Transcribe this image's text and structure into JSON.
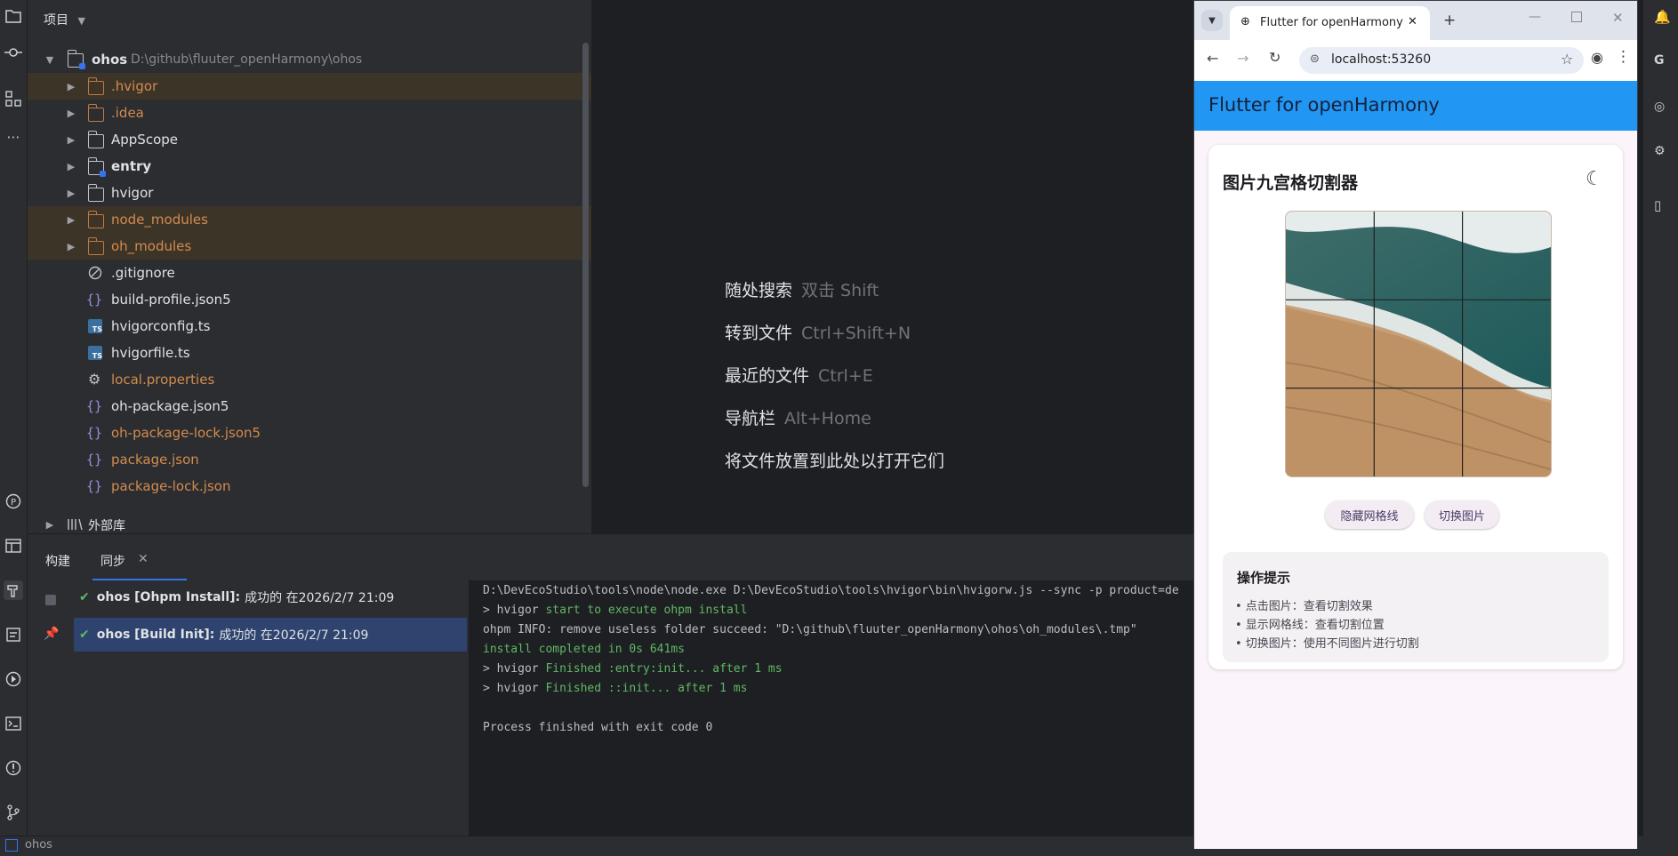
{
  "project_panel": {
    "header": "项目",
    "root": {
      "name": "ohos",
      "path": "D:\\github\\fluuter_openHarmony\\ohos"
    },
    "items": [
      {
        "label": ".hvigor",
        "kind": "folder",
        "color": "orange",
        "expandable": true,
        "highlight": true
      },
      {
        "label": ".idea",
        "kind": "folder",
        "color": "orange",
        "expandable": true,
        "highlight": false
      },
      {
        "label": "AppScope",
        "kind": "folder",
        "color": "default",
        "expandable": true,
        "highlight": false
      },
      {
        "label": "entry",
        "kind": "module",
        "color": "default",
        "expandable": true,
        "highlight": false
      },
      {
        "label": "hvigor",
        "kind": "folder",
        "color": "default",
        "expandable": true,
        "highlight": false
      },
      {
        "label": "node_modules",
        "kind": "folder",
        "color": "orange",
        "expandable": true,
        "highlight": true
      },
      {
        "label": "oh_modules",
        "kind": "folder",
        "color": "orange",
        "expandable": true,
        "highlight": true
      },
      {
        "label": ".gitignore",
        "kind": "ignore",
        "color": "default",
        "expandable": false,
        "highlight": false
      },
      {
        "label": "build-profile.json5",
        "kind": "json",
        "color": "default",
        "expandable": false,
        "highlight": false
      },
      {
        "label": "hvigorconfig.ts",
        "kind": "ts",
        "color": "default",
        "expandable": false,
        "highlight": false
      },
      {
        "label": "hvigorfile.ts",
        "kind": "ts",
        "color": "default",
        "expandable": false,
        "highlight": false
      },
      {
        "label": "local.properties",
        "kind": "gear",
        "color": "orange",
        "expandable": false,
        "highlight": false
      },
      {
        "label": "oh-package.json5",
        "kind": "json",
        "color": "default",
        "expandable": false,
        "highlight": false
      },
      {
        "label": "oh-package-lock.json5",
        "kind": "json",
        "color": "orange",
        "expandable": false,
        "highlight": false
      },
      {
        "label": "package.json",
        "kind": "json",
        "color": "orange",
        "expandable": false,
        "highlight": false
      },
      {
        "label": "package-lock.json",
        "kind": "json",
        "color": "orange",
        "expandable": false,
        "highlight": false
      }
    ],
    "external_libs": "外部库"
  },
  "editor": {
    "hints": [
      {
        "action": "随处搜索",
        "key": "双击 Shift"
      },
      {
        "action": "转到文件",
        "key": "Ctrl+Shift+N"
      },
      {
        "action": "最近的文件",
        "key": "Ctrl+E"
      },
      {
        "action": "导航栏",
        "key": "Alt+Home"
      },
      {
        "action": "将文件放置到此处以打开它们",
        "key": ""
      }
    ]
  },
  "build_panel": {
    "tabs": [
      "构建",
      "同步"
    ],
    "items": [
      {
        "title": "ohos [Ohpm Install]:",
        "status": "成功的 在2026/2/7 21:09"
      },
      {
        "title": "ohos [Build Init]:",
        "status": "成功的 在2026/2/7 21:09"
      }
    ],
    "console": [
      {
        "prefix": "",
        "text": "D:\\DevEcoStudio\\tools\\node\\node.exe D:\\DevEcoStudio\\tools\\hvigor\\bin\\hvigorw.js --sync -p product=de",
        "style": "normal"
      },
      {
        "prefix": "> hvigor ",
        "text": "start to execute ohpm install",
        "style": "green"
      },
      {
        "prefix": "",
        "text": "ohpm INFO: remove useless folder succeed: \"D:\\github\\fluuter_openHarmony\\ohos\\oh_modules\\.tmp\"",
        "style": "normal"
      },
      {
        "prefix": "",
        "text": "install completed in 0s 641ms",
        "style": "green"
      },
      {
        "prefix": "> hvigor ",
        "text": "Finished :entry:init... after 1 ms",
        "style": "green"
      },
      {
        "prefix": "> hvigor ",
        "text": "Finished ::init... after 1 ms",
        "style": "green"
      },
      {
        "prefix": "",
        "text": "",
        "style": "normal"
      },
      {
        "prefix": "",
        "text": "Process finished with exit code 0",
        "style": "normal"
      }
    ]
  },
  "status_bar": {
    "project": "ohos"
  },
  "browser": {
    "tab_title": "Flutter for openHarmony",
    "url": "localhost:53260"
  },
  "app": {
    "title": "Flutter for openHarmony",
    "card_title": "图片九宫格切割器",
    "theme_icon": "moon-icon",
    "buttons": {
      "hide_grid": "隐藏网格线",
      "switch_image": "切换图片"
    },
    "tips": {
      "title": "操作提示",
      "items": [
        "• 点击图片：查看切割效果",
        "• 显示网格线：查看切割位置",
        "• 切换图片：使用不同图片进行切割"
      ]
    }
  },
  "colors": {
    "accent": "#3574f0",
    "app_bar": "#2196f3",
    "success": "#5fb865",
    "ignored_file": "#d38b4e"
  }
}
